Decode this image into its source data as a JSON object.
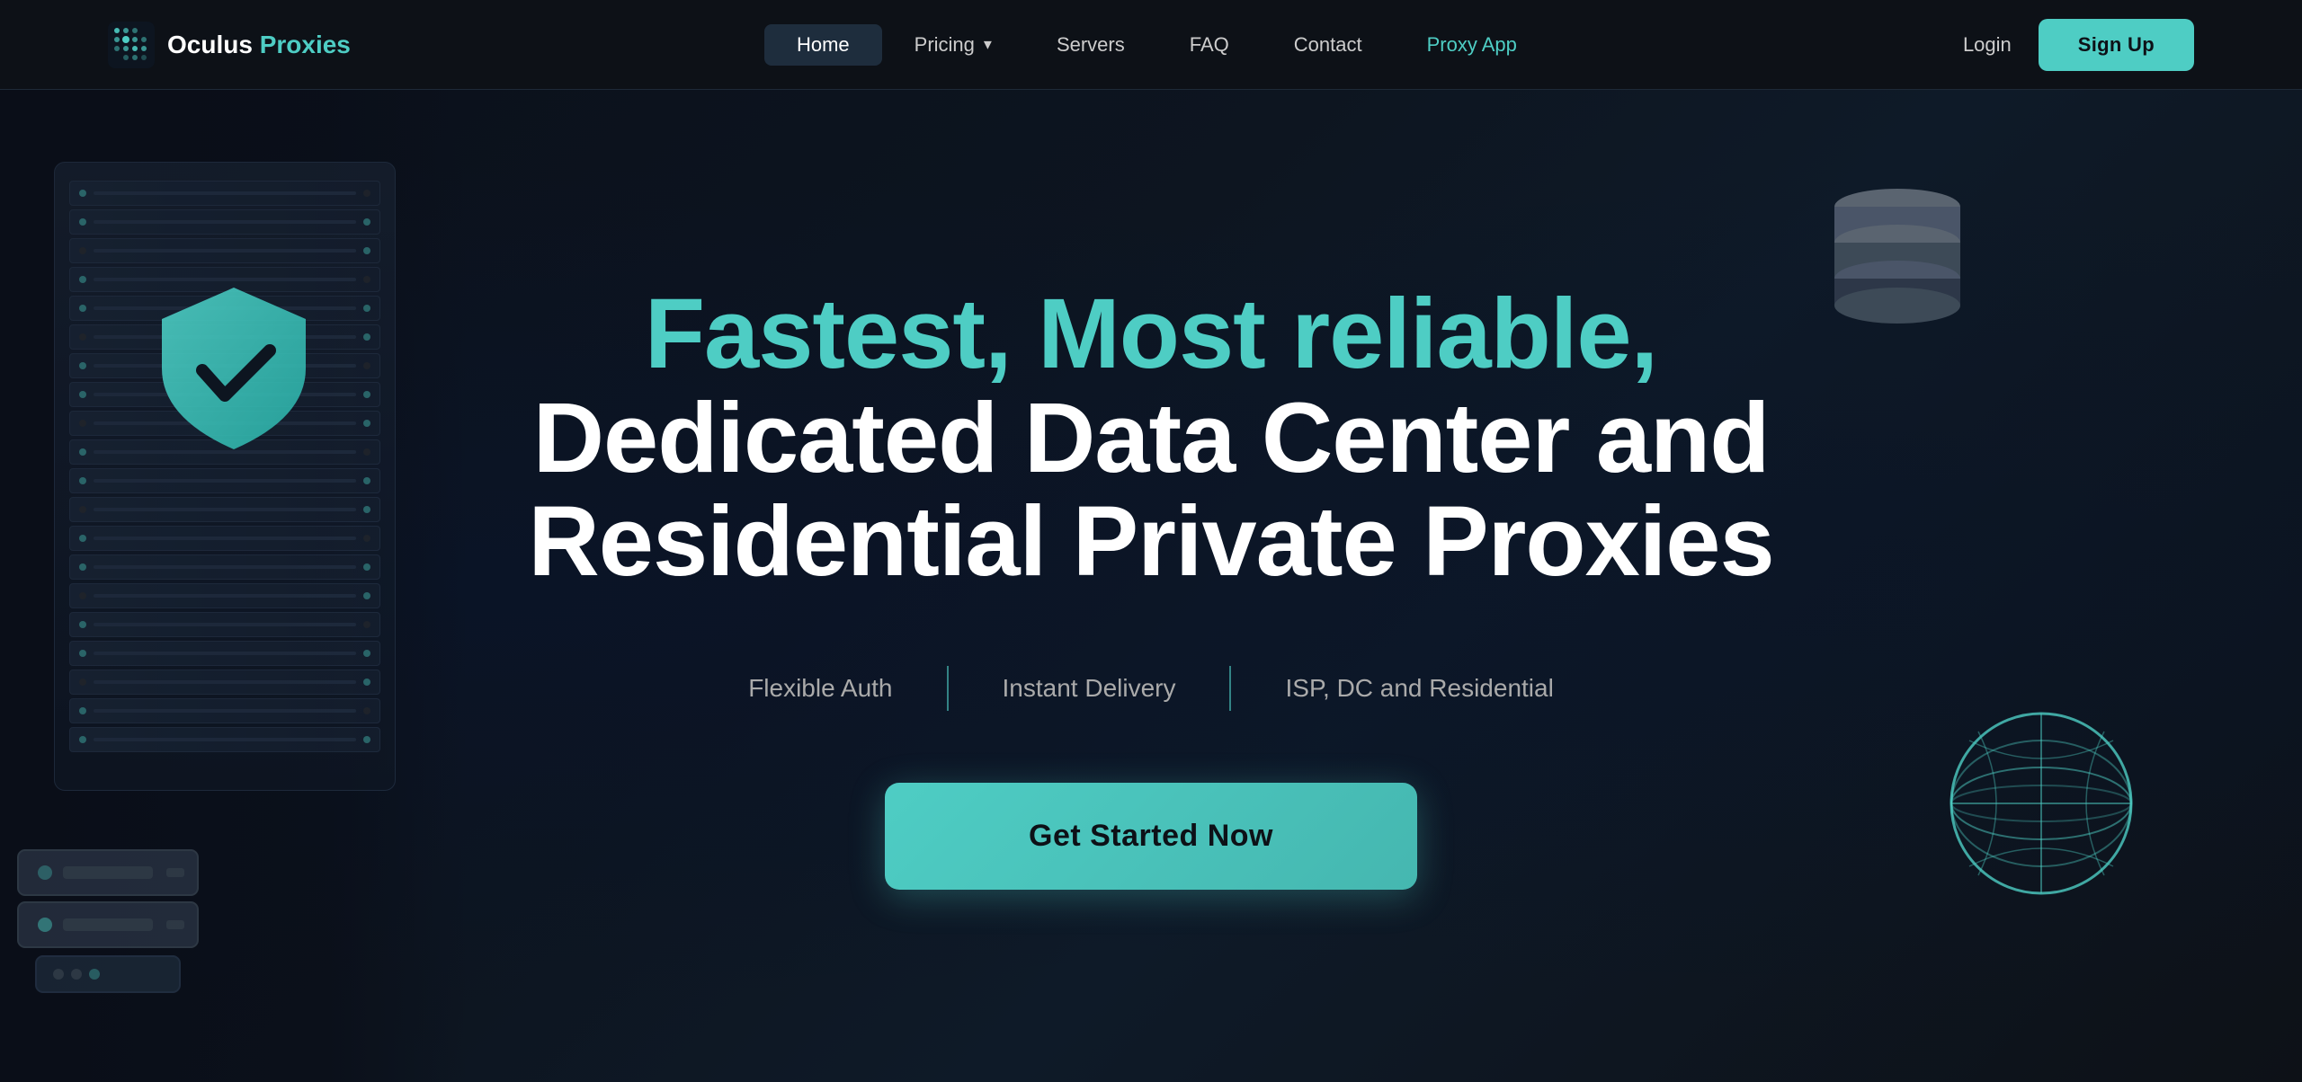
{
  "navbar": {
    "logo_text_main": "Oculus",
    "logo_text_accent": " Proxies",
    "links": [
      {
        "id": "home",
        "label": "Home",
        "active": true,
        "has_dropdown": false
      },
      {
        "id": "pricing",
        "label": "Pricing",
        "active": false,
        "has_dropdown": true
      },
      {
        "id": "servers",
        "label": "Servers",
        "active": false,
        "has_dropdown": false
      },
      {
        "id": "faq",
        "label": "FAQ",
        "active": false,
        "has_dropdown": false
      },
      {
        "id": "contact",
        "label": "Contact",
        "active": false,
        "has_dropdown": false
      },
      {
        "id": "proxy-app",
        "label": "Proxy App",
        "active": false,
        "has_dropdown": false,
        "accent": true
      }
    ],
    "login_label": "Login",
    "signup_label": "Sign Up"
  },
  "hero": {
    "title_line1": "Fastest, Most reliable,",
    "title_line2": "Dedicated Data Center and",
    "title_line3": "Residential Private Proxies",
    "features": [
      {
        "id": "flexible-auth",
        "label": "Flexible Auth"
      },
      {
        "id": "instant-delivery",
        "label": "Instant Delivery"
      },
      {
        "id": "isp-dc-residential",
        "label": "ISP, DC and Residential"
      }
    ],
    "cta_label": "Get Started Now"
  },
  "colors": {
    "accent": "#4ecdc4",
    "bg_dark": "#0d1117",
    "text_white": "#ffffff",
    "text_muted": "#aaaaaa"
  }
}
